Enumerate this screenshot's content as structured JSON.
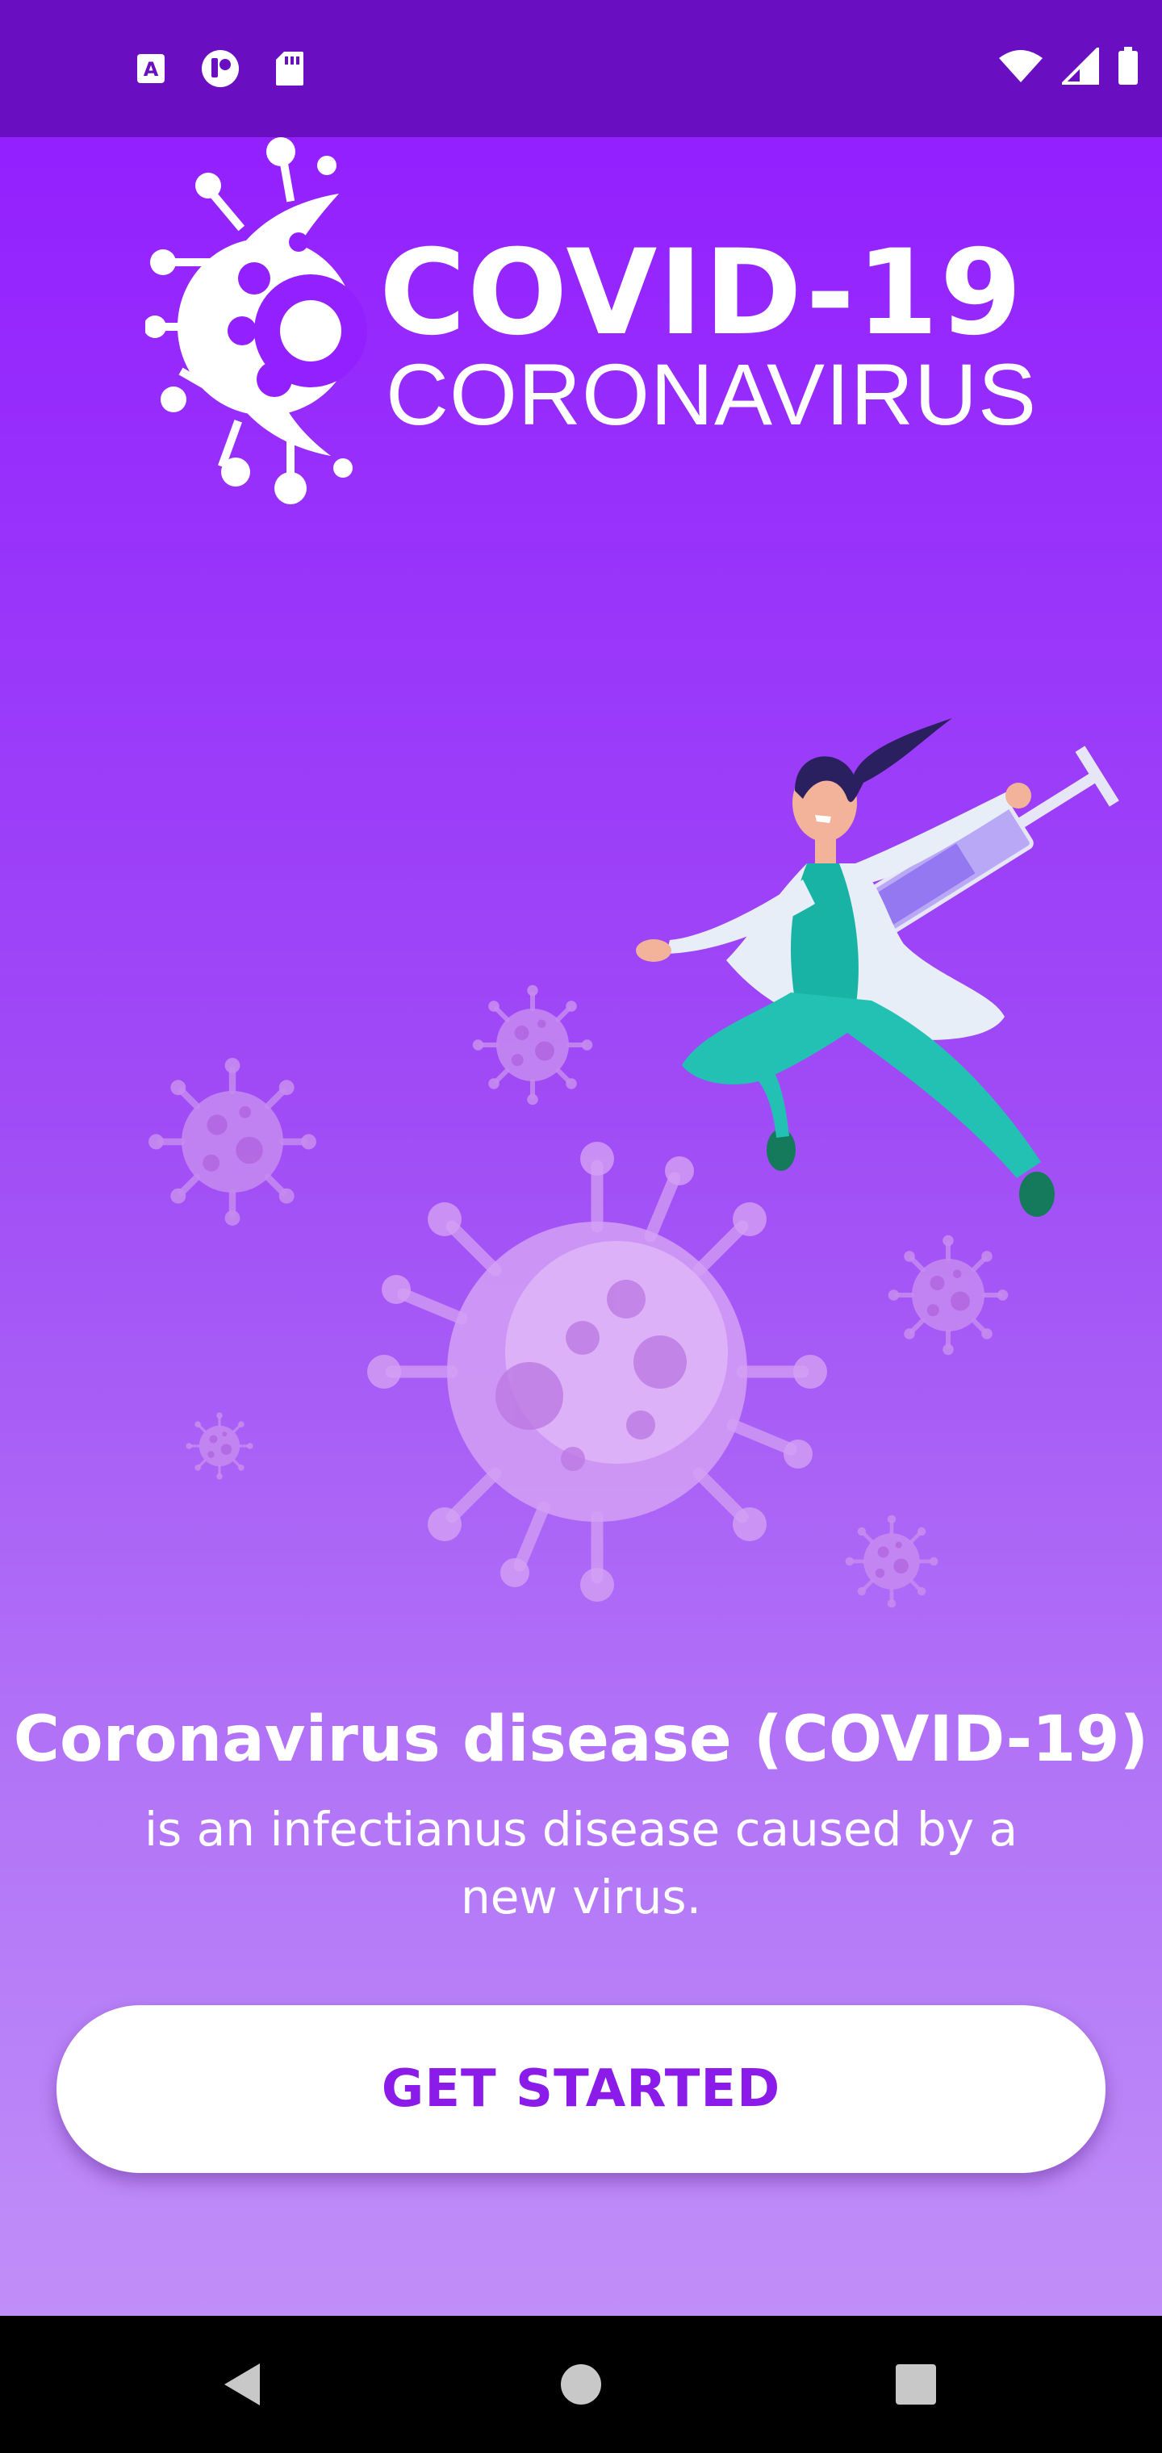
{
  "status_bar": {
    "left_icons": [
      "a-notification-icon",
      "media-notification-icon",
      "sd-card-icon"
    ],
    "right_icons": [
      "wifi-icon",
      "cellular-signal-icon",
      "battery-icon"
    ]
  },
  "logo": {
    "title": "COVID-19",
    "subtitle": "CORONAVIRUS"
  },
  "illustration": {
    "subject": "doctor-with-syringe",
    "elements": [
      "virus-icon"
    ]
  },
  "intro": {
    "headline": "Coronavirus disease (COVID-19)",
    "description": "is an infectianus disease caused by a new virus."
  },
  "cta": {
    "label": "GET STARTED"
  },
  "nav_bar": {
    "buttons": [
      "back-icon",
      "home-icon",
      "recents-icon"
    ]
  },
  "colors": {
    "status_bar": "#6a0ec2",
    "gradient_top": "#9320ff",
    "gradient_bottom": "#c08ef8",
    "button_text": "#8a1be8",
    "button_bg": "#ffffff"
  }
}
